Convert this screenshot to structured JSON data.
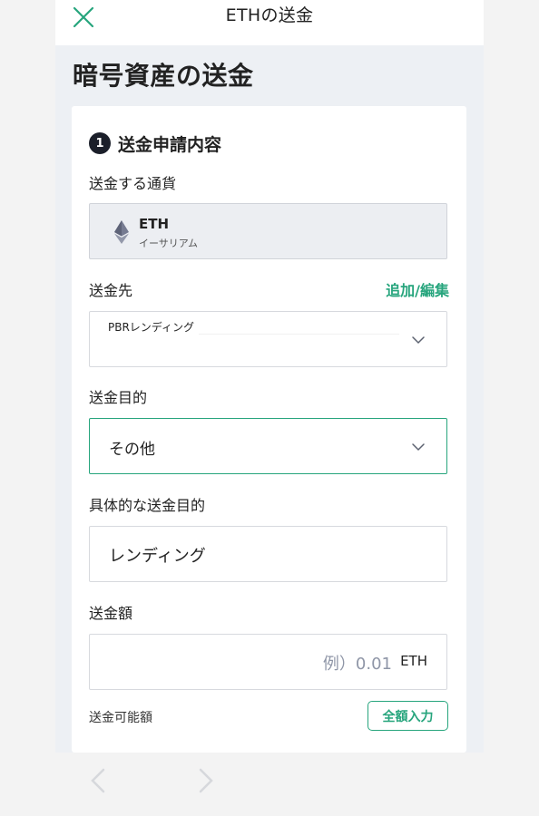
{
  "topbar": {
    "title": "ETHの送金"
  },
  "page": {
    "title": "暗号資産の送金"
  },
  "section": {
    "step": "1",
    "title": "送金申請内容"
  },
  "currency": {
    "label": "送金する通貨",
    "code": "ETH",
    "name": "イーサリアム"
  },
  "destination": {
    "label": "送金先",
    "action": "追加/編集",
    "value": "PBRレンディング"
  },
  "purpose": {
    "label": "送金目的",
    "value": "その他"
  },
  "specific_purpose": {
    "label": "具体的な送金目的",
    "value": "レンディング"
  },
  "amount": {
    "label": "送金額",
    "placeholder": "例）0.01",
    "unit": "ETH",
    "available_label": "送金可能額",
    "fill_all_button": "全額入力"
  },
  "colors": {
    "accent": "#27a57d",
    "background": "#edf0f4",
    "badge": "#1b1f2a"
  },
  "icons": {
    "close": "close-icon",
    "eth": "ethereum-icon",
    "chevron": "chevron-down-icon",
    "back": "chevron-left-icon",
    "forward": "chevron-right-icon"
  }
}
